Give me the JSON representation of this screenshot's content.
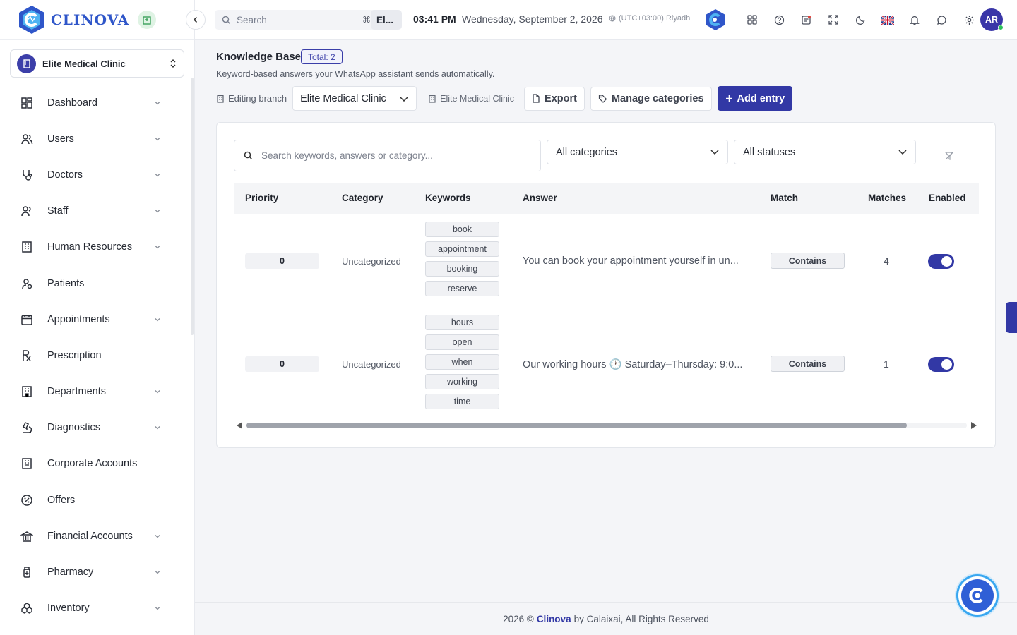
{
  "brand": {
    "name": "CLINOVA"
  },
  "sidebar": {
    "branch": "Elite Medical Clinic",
    "items": [
      {
        "label": "Dashboard",
        "icon": "dashboard-icon",
        "chevron": true
      },
      {
        "label": "Users",
        "icon": "users-icon",
        "chevron": true
      },
      {
        "label": "Doctors",
        "icon": "stethoscope-icon",
        "chevron": true
      },
      {
        "label": "Staff",
        "icon": "staff-icon",
        "chevron": true
      },
      {
        "label": "Human Resources",
        "icon": "building-icon",
        "chevron": true
      },
      {
        "label": "Patients",
        "icon": "patient-icon",
        "chevron": false
      },
      {
        "label": "Appointments",
        "icon": "calendar-icon",
        "chevron": true
      },
      {
        "label": "Prescription",
        "icon": "rx-icon",
        "chevron": false
      },
      {
        "label": "Departments",
        "icon": "department-icon",
        "chevron": true
      },
      {
        "label": "Diagnostics",
        "icon": "microscope-icon",
        "chevron": true
      },
      {
        "label": "Corporate Accounts",
        "icon": "corporate-icon",
        "chevron": false
      },
      {
        "label": "Offers",
        "icon": "percent-icon",
        "chevron": false
      },
      {
        "label": "Financial Accounts",
        "icon": "bank-icon",
        "chevron": true
      },
      {
        "label": "Pharmacy",
        "icon": "pill-bottle-icon",
        "chevron": true
      },
      {
        "label": "Inventory",
        "icon": "boxes-icon",
        "chevron": true
      }
    ]
  },
  "topbar": {
    "search_placeholder": "Search",
    "search_shortcut": "⌘",
    "branch_chip": "El...",
    "time": "03:41 PM",
    "date": "Wednesday, September 2, 2026",
    "timezone": "(UTC+03:00) Riyadh",
    "user_initials": "AR"
  },
  "page": {
    "title": "Knowledge Base",
    "total_badge": "Total: 2",
    "subtitle": "Keyword-based answers your WhatsApp assistant sends automatically.",
    "editing_branch_label": "Editing branch",
    "editing_branch_value": "Elite Medical Clinic",
    "branch_label": "Elite Medical Clinic",
    "export_label": "Export",
    "manage_categories_label": "Manage categories",
    "add_entry_label": "Add entry"
  },
  "filters": {
    "search_placeholder": "Search keywords, answers or category...",
    "category": "All categories",
    "status": "All statuses"
  },
  "table": {
    "columns": [
      "Priority",
      "Category",
      "Keywords",
      "Answer",
      "Match",
      "Matches",
      "Enabled"
    ],
    "rows": [
      {
        "priority": "0",
        "category": "Uncategorized",
        "keywords": [
          "book",
          "appointment",
          "booking",
          "reserve"
        ],
        "answer": "You can book your appointment yourself in un...",
        "match": "Contains",
        "matches": "4",
        "enabled": true
      },
      {
        "priority": "0",
        "category": "Uncategorized",
        "keywords": [
          "hours",
          "open",
          "when",
          "working",
          "time"
        ],
        "answer": "Our working hours 🕐 Saturday–Thursday: 9:0...",
        "match": "Contains",
        "matches": "1",
        "enabled": true
      }
    ]
  },
  "footer": {
    "prefix": "2026 ©",
    "brand": "Clinova",
    "suffix": "by Calaixai, All Rights Reserved"
  },
  "colors": {
    "primary": "#3238a5",
    "brand_blue": "#2f56c9",
    "accent_cyan": "#39a7f0"
  }
}
